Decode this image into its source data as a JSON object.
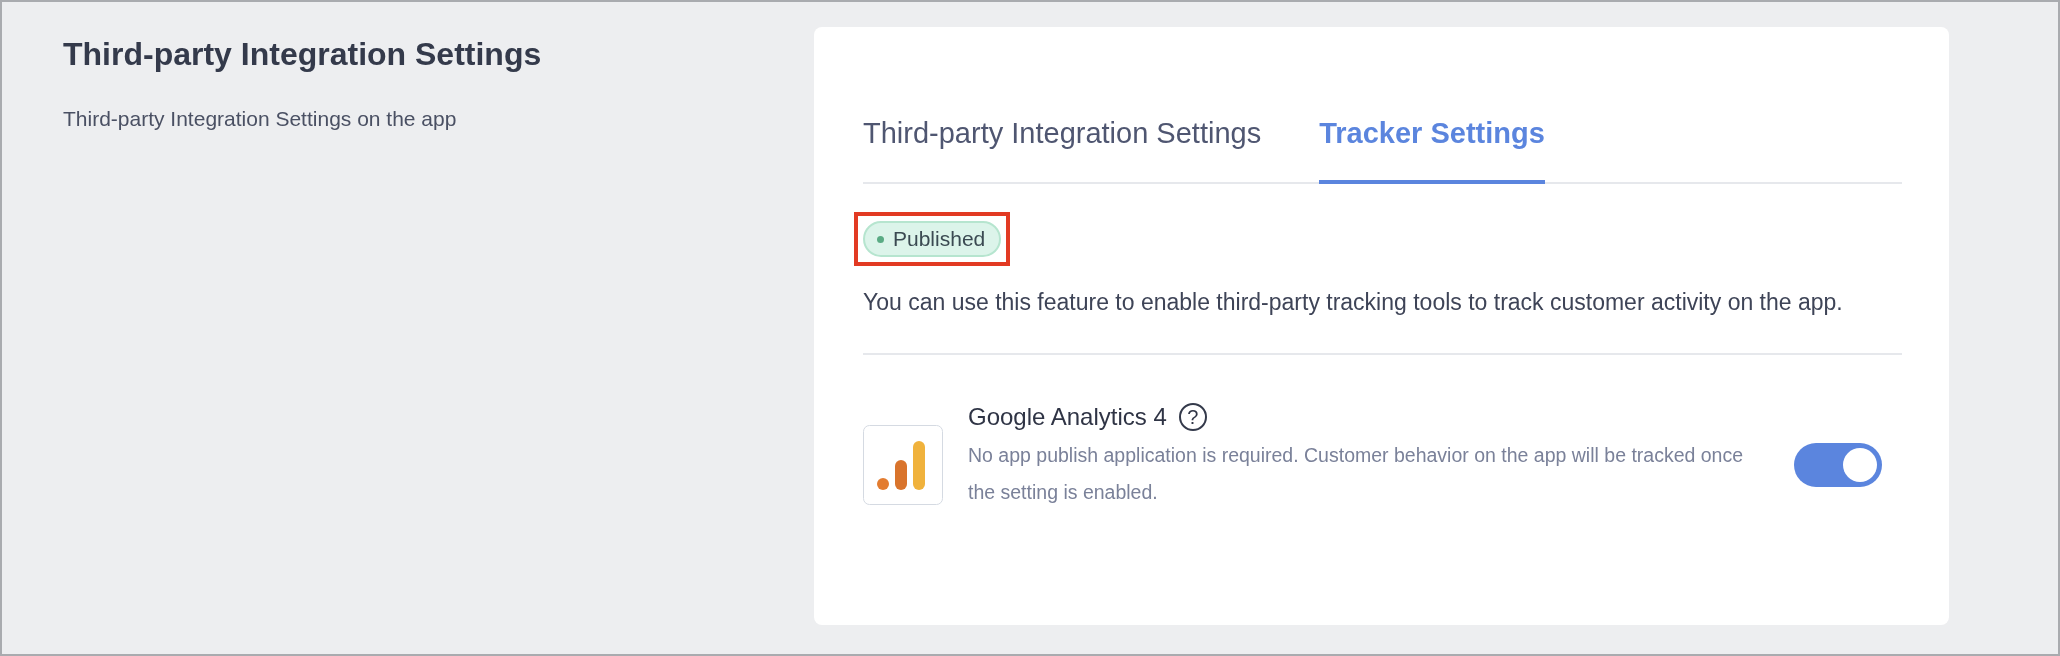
{
  "page": {
    "title": "Third-party Integration Settings",
    "subtitle": "Third-party Integration Settings on the app"
  },
  "tabs": [
    {
      "label": "Third-party Integration Settings",
      "selected": false
    },
    {
      "label": "Tracker Settings",
      "selected": true
    }
  ],
  "status_badge": {
    "label": "Published",
    "highlighted": true
  },
  "description": "You can use this feature to enable third-party tracking tools to track customer activity on the app.",
  "trackers": [
    {
      "name": "Google Analytics 4",
      "help_icon": "?",
      "description": "No app publish application is required. Customer behavior on the app will be tracked once the setting is enabled.",
      "on": true
    }
  ]
}
